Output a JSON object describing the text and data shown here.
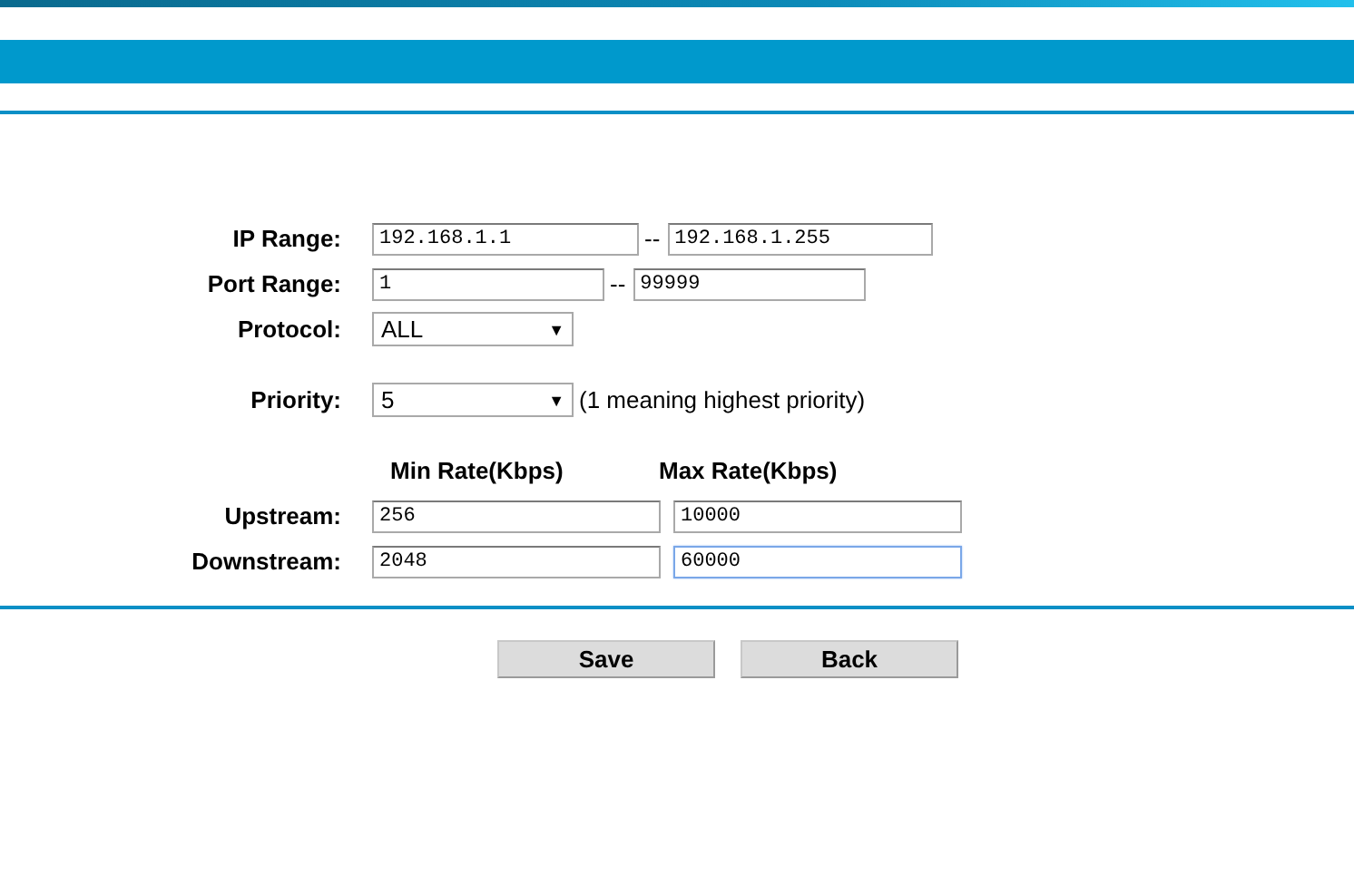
{
  "ip_range": {
    "label": "IP Range:",
    "start": "192.168.1.1",
    "separator": "--",
    "end": "192.168.1.255"
  },
  "port_range": {
    "label": "Port Range:",
    "start": "1",
    "separator": "--",
    "end": "99999"
  },
  "protocol": {
    "label": "Protocol:",
    "value": "ALL",
    "arrow": "▼"
  },
  "priority": {
    "label": "Priority:",
    "value": "5",
    "arrow": "▼",
    "hint": "(1 meaning highest priority)"
  },
  "rates": {
    "columns": [
      "Min Rate(Kbps)",
      "Max Rate(Kbps)"
    ],
    "rows": [
      {
        "label": "Upstream:",
        "min": {
          "value": "256",
          "focused": false
        },
        "max": {
          "value": "10000",
          "focused": false
        }
      },
      {
        "label": "Downstream:",
        "min": {
          "value": "2048",
          "focused": false
        },
        "max": {
          "value": "60000",
          "focused": true
        }
      }
    ]
  },
  "buttons": [
    "Save",
    "Back"
  ]
}
